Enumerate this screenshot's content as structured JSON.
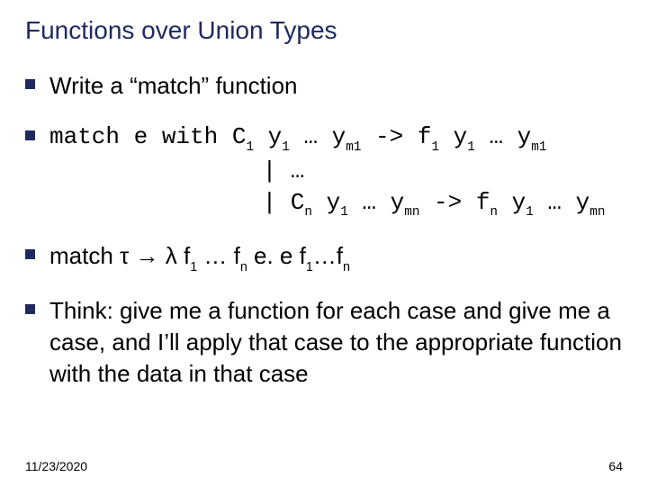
{
  "title": "Functions over Union Types",
  "bullets": {
    "b1": "Write a “match” function",
    "b2": {
      "line1_a": "match e with C",
      "line1_b": " y",
      "line1_c": " … y",
      "line1_d": " -> f",
      "line1_e": " y",
      "line1_f": " … y",
      "s1": "1",
      "s2": "1",
      "s3": "m1",
      "s4": "1",
      "s5": "1",
      "s6": "m1",
      "line2": "| …",
      "line3_a": "| C",
      "line3_b": " y",
      "line3_c": " … y",
      "line3_d": " -> f",
      "line3_e": " y",
      "line3_f": " … y",
      "t1": "n",
      "t2": "1",
      "t3": "mn",
      "t4": "n",
      "t5": "1",
      "t6": "mn"
    },
    "b3": {
      "p1": "match τ →  λ f",
      "s1": "1",
      "p2": " … f",
      "s2": "n",
      "p3": " e. e f",
      "s3": "1",
      "p4": "…f",
      "s4": "n"
    },
    "b4": "Think: give me a function for each case and give me a case, and I’ll apply that case to the appropriate function with the data in that case"
  },
  "footer": {
    "date": "11/23/2020",
    "page": "64"
  }
}
